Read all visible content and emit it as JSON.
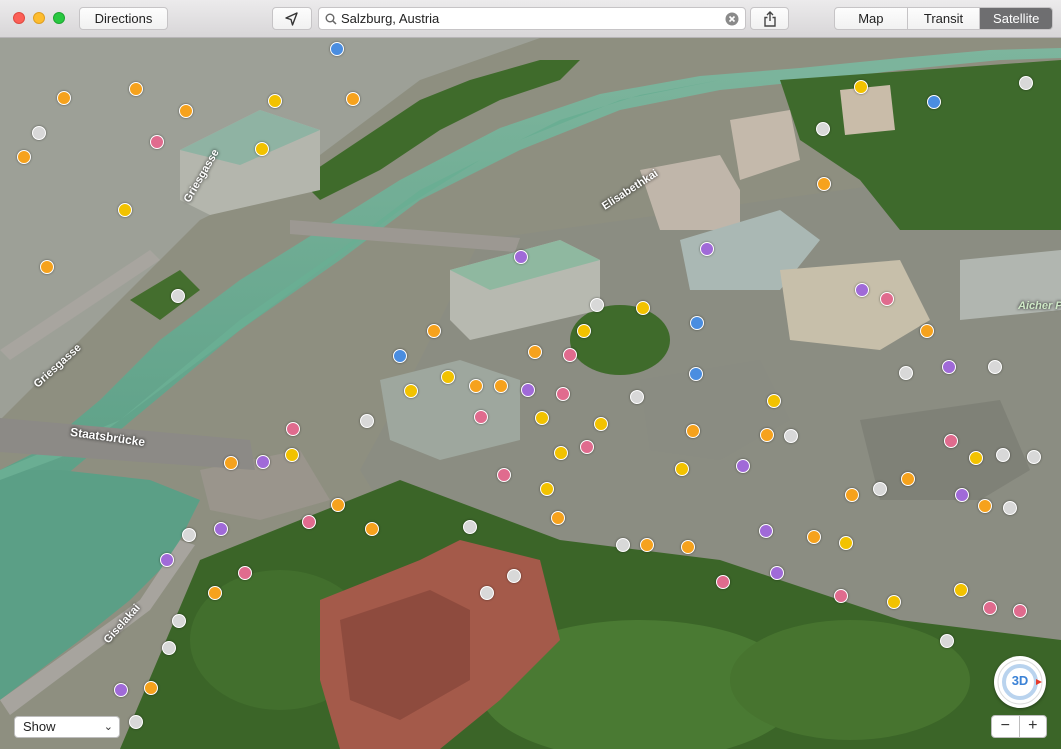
{
  "toolbar": {
    "directions_label": "Directions",
    "search_value": "Salzburg, Austria",
    "map_modes": [
      "Map",
      "Transit",
      "Satellite"
    ],
    "active_mode": "Satellite"
  },
  "map": {
    "street_labels": [
      "Griesgasse",
      "Griesgasse",
      "Elisabethkai",
      "Staatsbrücke",
      "Giselakai",
      "Aicher Pa"
    ],
    "compass_label": "3D"
  },
  "controls": {
    "show_label": "Show",
    "zoom_out": "−",
    "zoom_in": "+"
  },
  "colors": {
    "river": "#64a88d",
    "roof_red": "#a45a4a",
    "trees": "#3f6b2b",
    "selected_segment": "#6e6e70"
  }
}
